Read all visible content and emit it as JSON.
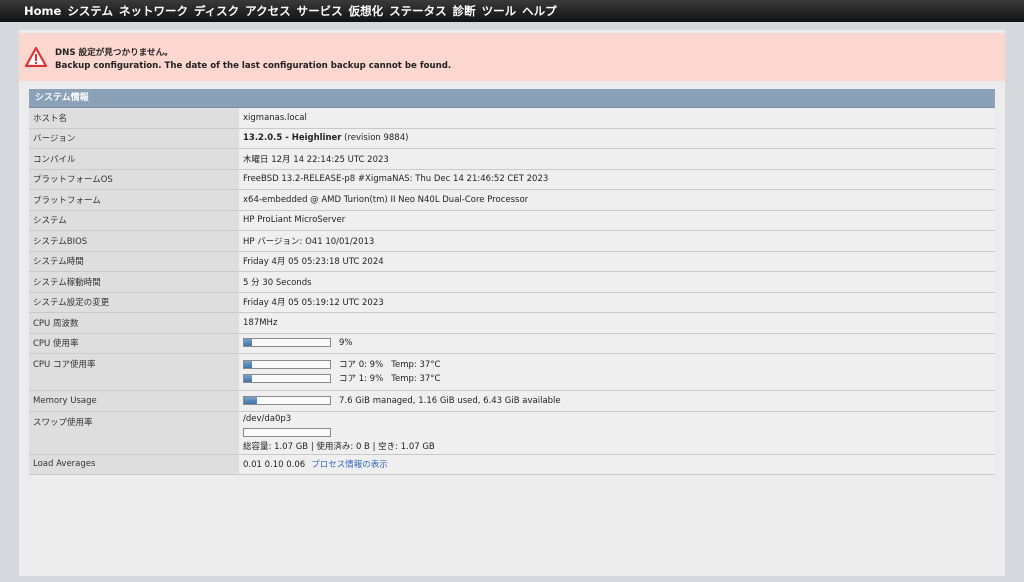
{
  "nav": [
    "Home",
    "システム",
    "ネットワーク",
    "ディスク",
    "アクセス",
    "サービス",
    "仮想化",
    "ステータス",
    "診断",
    "ツール",
    "ヘルプ"
  ],
  "alert": {
    "line1": "DNS 設定が見つかりません。",
    "line2": "Backup configuration. The date of the last configuration backup cannot be found."
  },
  "panel_title": "システム情報",
  "rows": {
    "hostname": {
      "label": "ホスト名",
      "value": "xigmanas.local"
    },
    "version": {
      "label": "バージョン",
      "bold": "13.2.0.5 - Heighliner",
      "rest": " (revision 9884)"
    },
    "compiled": {
      "label": "コンパイル",
      "value": "木曜日 12月 14 22:14:25 UTC 2023"
    },
    "platform_os": {
      "label": "プラットフォームOS",
      "value": "FreeBSD 13.2-RELEASE-p8 #XigmaNAS: Thu Dec 14 21:46:52 CET 2023"
    },
    "platform": {
      "label": "プラットフォーム",
      "value": "x64-embedded @ AMD Turion(tm) II Neo N40L Dual-Core Processor"
    },
    "system": {
      "label": "システム",
      "value": "HP ProLiant MicroServer"
    },
    "bios": {
      "label": "システムBIOS",
      "value": "HP バージョン: O41 10/01/2013"
    },
    "time": {
      "label": "システム時間",
      "value": "Friday 4月 05 05:23:18 UTC 2024"
    },
    "uptime": {
      "label": "システム稼動時間",
      "value": "5 分 30 Seconds"
    },
    "config_change": {
      "label": "システム設定の変更",
      "value": "Friday 4月 05 05:19:12 UTC 2023"
    },
    "cpu_freq": {
      "label": "CPU 周波数",
      "value": "187MHz"
    },
    "cpu_usage": {
      "label": "CPU 使用率",
      "value": "9%",
      "fraction": 0.09
    },
    "cpu_cores": {
      "label": "CPU コア使用率",
      "cores": [
        {
          "text": "コア 0: 9%   Temp: 37°C",
          "fraction": 0.09
        },
        {
          "text": "コア 1: 9%   Temp: 37°C",
          "fraction": 0.09
        }
      ]
    },
    "memory": {
      "label": "Memory Usage",
      "value": "7.6 GiB managed, 1.16 GiB used, 6.43 GiB available",
      "fraction": 0.15
    },
    "swap": {
      "label": "スワップ使用率",
      "device": "/dev/da0p3",
      "fraction": 0,
      "summary": "総容量: 1.07 GB | 使用済み: 0 B | 空き: 1.07 GB"
    },
    "load": {
      "label": "Load Averages",
      "value": "0.01 0.10 0.06",
      "link": "プロセス情報の表示"
    }
  },
  "colors": {
    "accent": "#8aa1b8",
    "alert_bg": "#fcd7cf",
    "link": "#3366bb",
    "bar_fill": "#3e72a8"
  }
}
